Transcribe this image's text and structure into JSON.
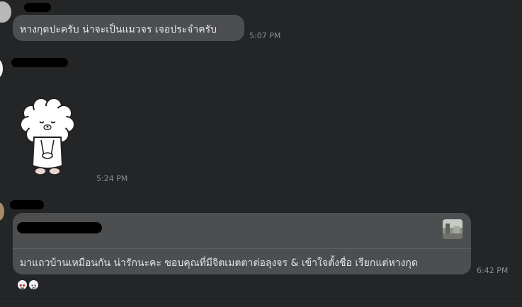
{
  "messages": [
    {
      "text": "หางกุดปะครับ น่าจะเป็นแมวจร เจอประจำครับ",
      "time": "5:07 PM"
    },
    {
      "sticker": "bear-bowing-sticker",
      "time": "5:24 PM"
    },
    {
      "text": "มาแถวบ้านเหมือนกัน น่ารักนะคะ ขอบคุณที่มีจิตเมตตาต่อลุงจร & เข้าใจตั้งชื่อ เรียกแต่หางกุด",
      "time": "6:42 PM",
      "reactions": [
        "angry-face-icon",
        "sad-face-icon"
      ]
    }
  ],
  "colors": {
    "background": "#242526",
    "bubble": "#3e4042",
    "text": "#e4e6eb",
    "timestamp": "#8a8d91"
  }
}
